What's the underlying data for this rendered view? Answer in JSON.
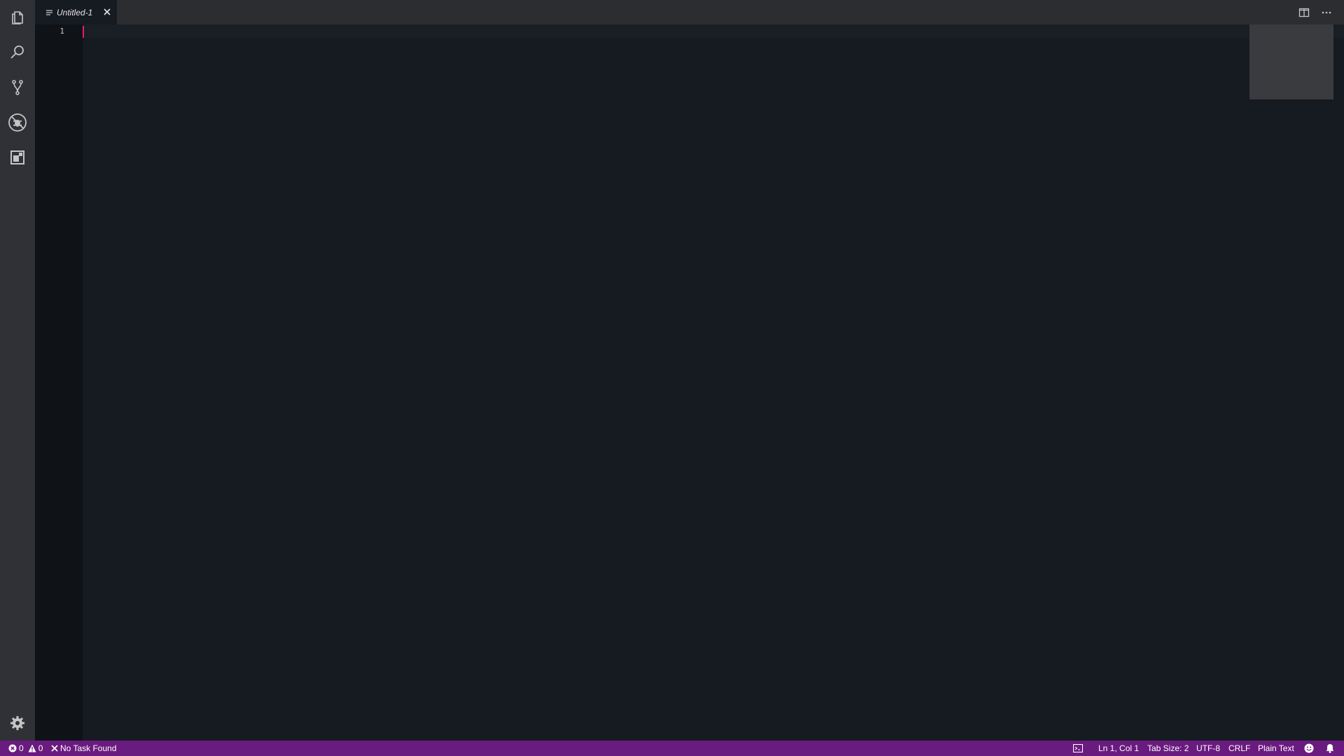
{
  "tabs": [
    {
      "label": "Untitled-1"
    }
  ],
  "editor": {
    "line_numbers": [
      "1"
    ]
  },
  "status_bar": {
    "errors": "0",
    "warnings": "0",
    "task_status": "No Task Found",
    "cursor_position": "Ln 1, Col 1",
    "tab_size": "Tab Size: 2",
    "encoding": "UTF-8",
    "line_ending": "CRLF",
    "language": "Plain Text"
  },
  "icons": {
    "activity_bar": [
      "files-icon",
      "search-icon",
      "source-control-icon",
      "debug-icon",
      "extensions-icon",
      "gear-icon"
    ],
    "tab": [
      "file-lines-icon",
      "close-icon"
    ],
    "editor_actions": [
      "split-editor-icon",
      "more-actions-icon"
    ],
    "status_bar": [
      "error-icon",
      "warning-icon",
      "close-icon",
      "terminal-icon",
      "smiley-icon",
      "bell-icon"
    ]
  },
  "colors": {
    "status_bar": "#6a1b7f",
    "cursor": "#e91e63",
    "editor_background": "#161a21",
    "activity_bar": "#2f3136"
  }
}
